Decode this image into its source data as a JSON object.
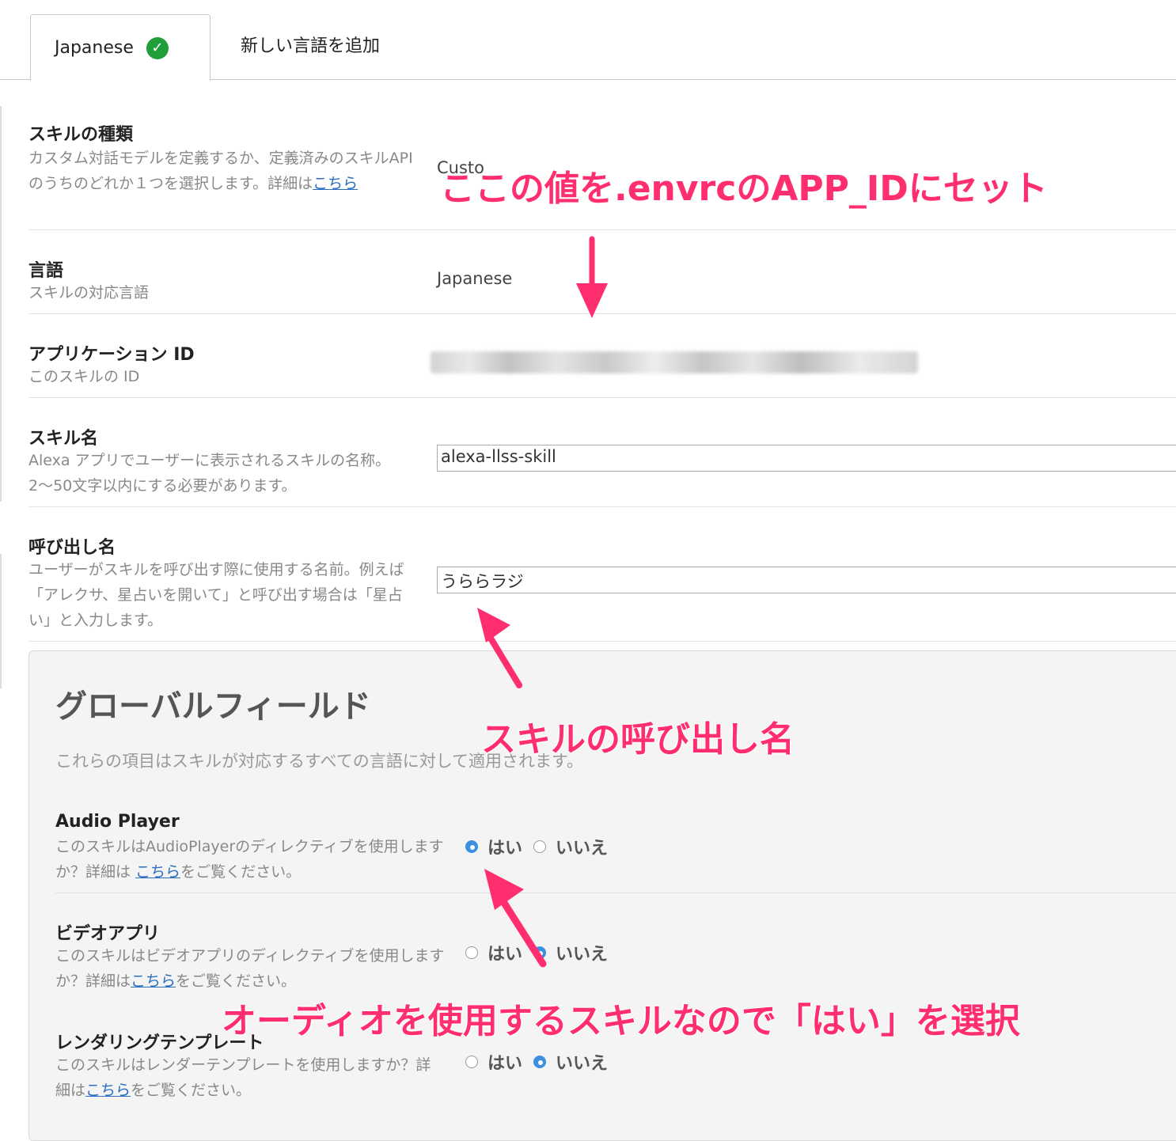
{
  "tabs": [
    {
      "label": "Japanese",
      "active": true,
      "status_icon": "check-circle-icon"
    },
    {
      "label": "新しい言語を追加",
      "active": false
    }
  ],
  "rows": {
    "skill_type": {
      "title": "スキルの種類",
      "desc_pre": "カスタム対話モデルを定義するか、定義済みのスキルAPIのうちのどれか１つを選択します。詳細は",
      "desc_link": "こちら",
      "value_partial": "Custo"
    },
    "language": {
      "title": "言語",
      "desc": "スキルの対応言語",
      "value": "Japanese"
    },
    "app_id": {
      "title": "アプリケーション ID",
      "desc": "このスキルの ID"
    },
    "skill_name": {
      "title": "スキル名",
      "desc": "Alexa アプリでユーザーに表示されるスキルの名称。2〜50文字以内にする必要があります。",
      "value": "alexa-llss-skill"
    },
    "invocation": {
      "title": "呼び出し名",
      "desc": "ユーザーがスキルを呼び出す際に使用する名前。例えば「アレクサ、星占いを開いて」と呼び出す場合は「星占い」と入力します。",
      "value": "うららラジ"
    }
  },
  "global": {
    "title": "グローバルフィールド",
    "desc": "これらの項目はスキルが対応するすべての言語に対して適用されます。",
    "fields": [
      {
        "title": "Audio Player",
        "desc_pre": "このスキルはAudioPlayerのディレクティブを使用しますか？詳細は ",
        "desc_link": "こちら",
        "desc_post": "をご覧ください。",
        "selected": "yes"
      },
      {
        "title": "ビデオアプリ",
        "desc_pre": "このスキルはビデオアプリのディレクティブを使用しますか？詳細は",
        "desc_link": "こちら",
        "desc_post": "をご覧ください。",
        "selected": "no"
      },
      {
        "title": "レンダリングテンプレート",
        "desc_pre": "このスキルはレンダーテンプレートを使用しますか？詳細は",
        "desc_link": "こちら",
        "desc_post": "をご覧ください。",
        "selected": "no"
      }
    ],
    "yes_label": "はい",
    "no_label": "いいえ"
  },
  "annotations": {
    "app_id_note": "ここの値を.envrcのAPP_IDにセット",
    "invocation_note": "スキルの呼び出し名",
    "audio_note": "オーディオを使用するスキルなので「はい」を選択"
  },
  "colors": {
    "annotation": "#ff2e6e",
    "link": "#2a6ebf",
    "radio_selected": "#3d8fe0",
    "check": "#1f9e3a"
  }
}
